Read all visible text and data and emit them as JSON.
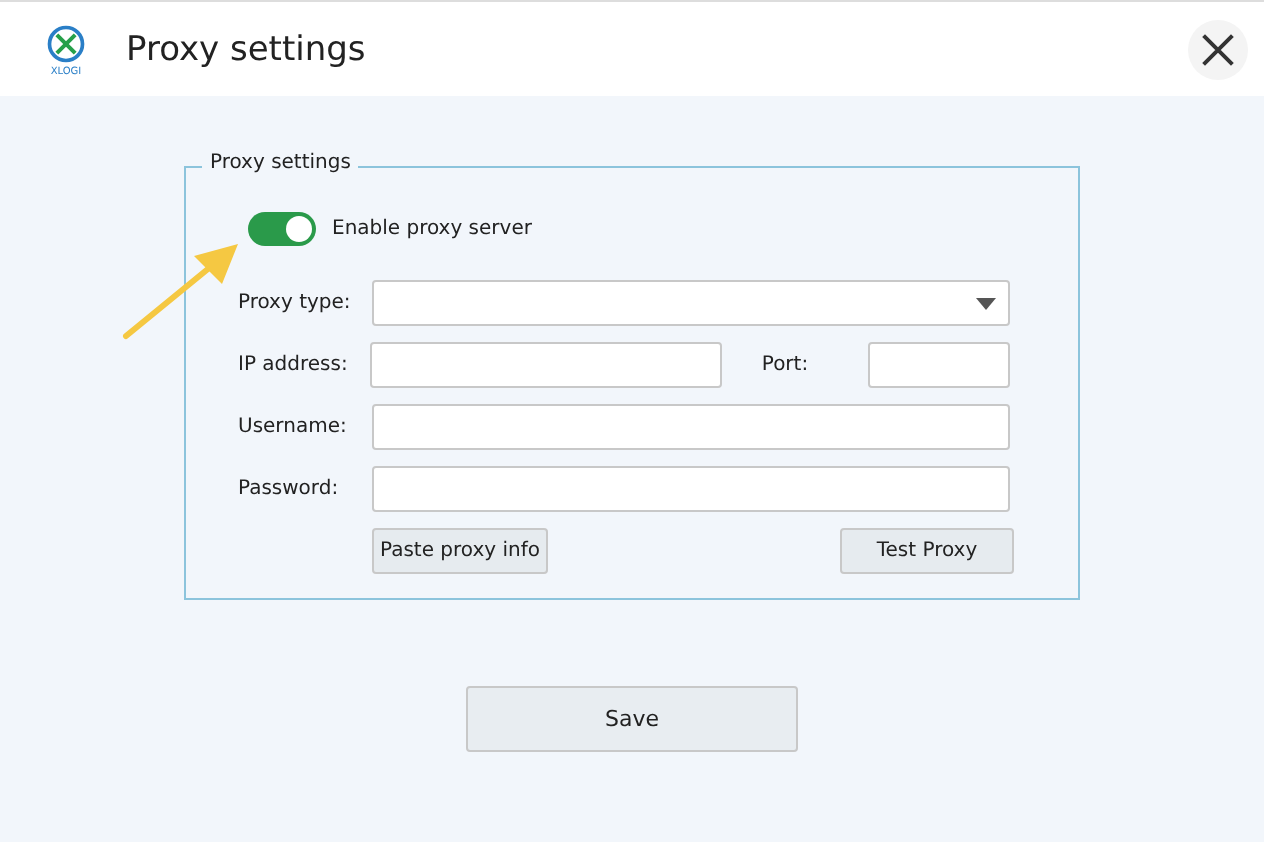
{
  "window": {
    "title": "Proxy settings",
    "logo_text": "XLOGI"
  },
  "group": {
    "title": "Proxy settings",
    "toggle": {
      "label": "Enable proxy server",
      "on": true
    },
    "fields": [
      {
        "kind": "dropdown",
        "label": "Proxy type:"
      },
      {
        "kind": "ip_port",
        "label": "IP address:",
        "port_label": "Port:"
      },
      {
        "kind": "text",
        "label": "Username:"
      },
      {
        "kind": "text",
        "label": "Password:"
      }
    ],
    "buttons": [
      "Paste proxy info",
      "Test Proxy"
    ]
  },
  "save_button": "Save"
}
